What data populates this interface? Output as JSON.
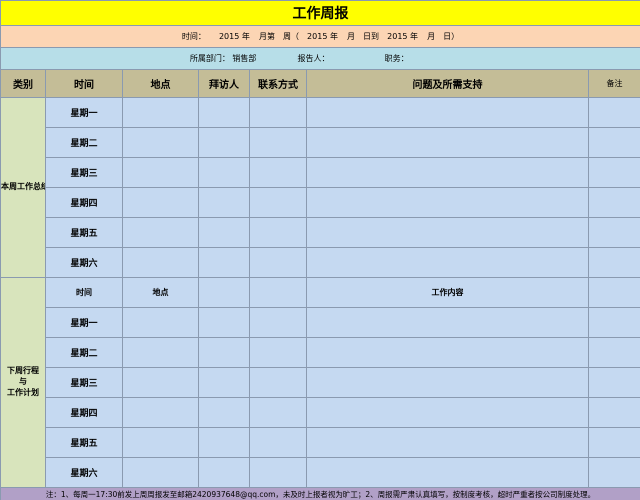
{
  "title": "工作周报",
  "time_line": {
    "label": "时间：",
    "year1": "2015",
    "nian1": "年",
    "week_text": "月第　周（",
    "year2": "2015",
    "nian2": "年",
    "month_day_to": "月　日到",
    "year3": "2015",
    "nian3": "年",
    "month_day_end": "月　日）"
  },
  "dept_line": {
    "dept_label": "所属部门：",
    "dept_value": "销售部",
    "reporter_label": "报告人：",
    "position_label": "职务："
  },
  "headers": {
    "category": "类别",
    "time": "时间",
    "place": "地点",
    "visitor": "拜访人",
    "contact": "联系方式",
    "issues": "问题及所需支持",
    "note": "备注"
  },
  "section1": {
    "category": "本周工作总结",
    "days": [
      "星期一",
      "星期二",
      "星期三",
      "星期四",
      "星期五",
      "星期六"
    ]
  },
  "section2": {
    "category_line1": "下周行程",
    "category_line2": "与",
    "category_line3": "工作计划",
    "sub_time": "时间",
    "sub_place": "地点",
    "sub_content": "工作内容",
    "days": [
      "星期一",
      "星期二",
      "星期三",
      "星期四",
      "星期五",
      "星期六"
    ]
  },
  "footer": "注：1、每周一17:30前发上周周报发至邮箱2420937648@qq.com，未及时上报者视为旷工；2、周报需严肃认真填写，按制度考核，超时严重者按公司制度处理。"
}
